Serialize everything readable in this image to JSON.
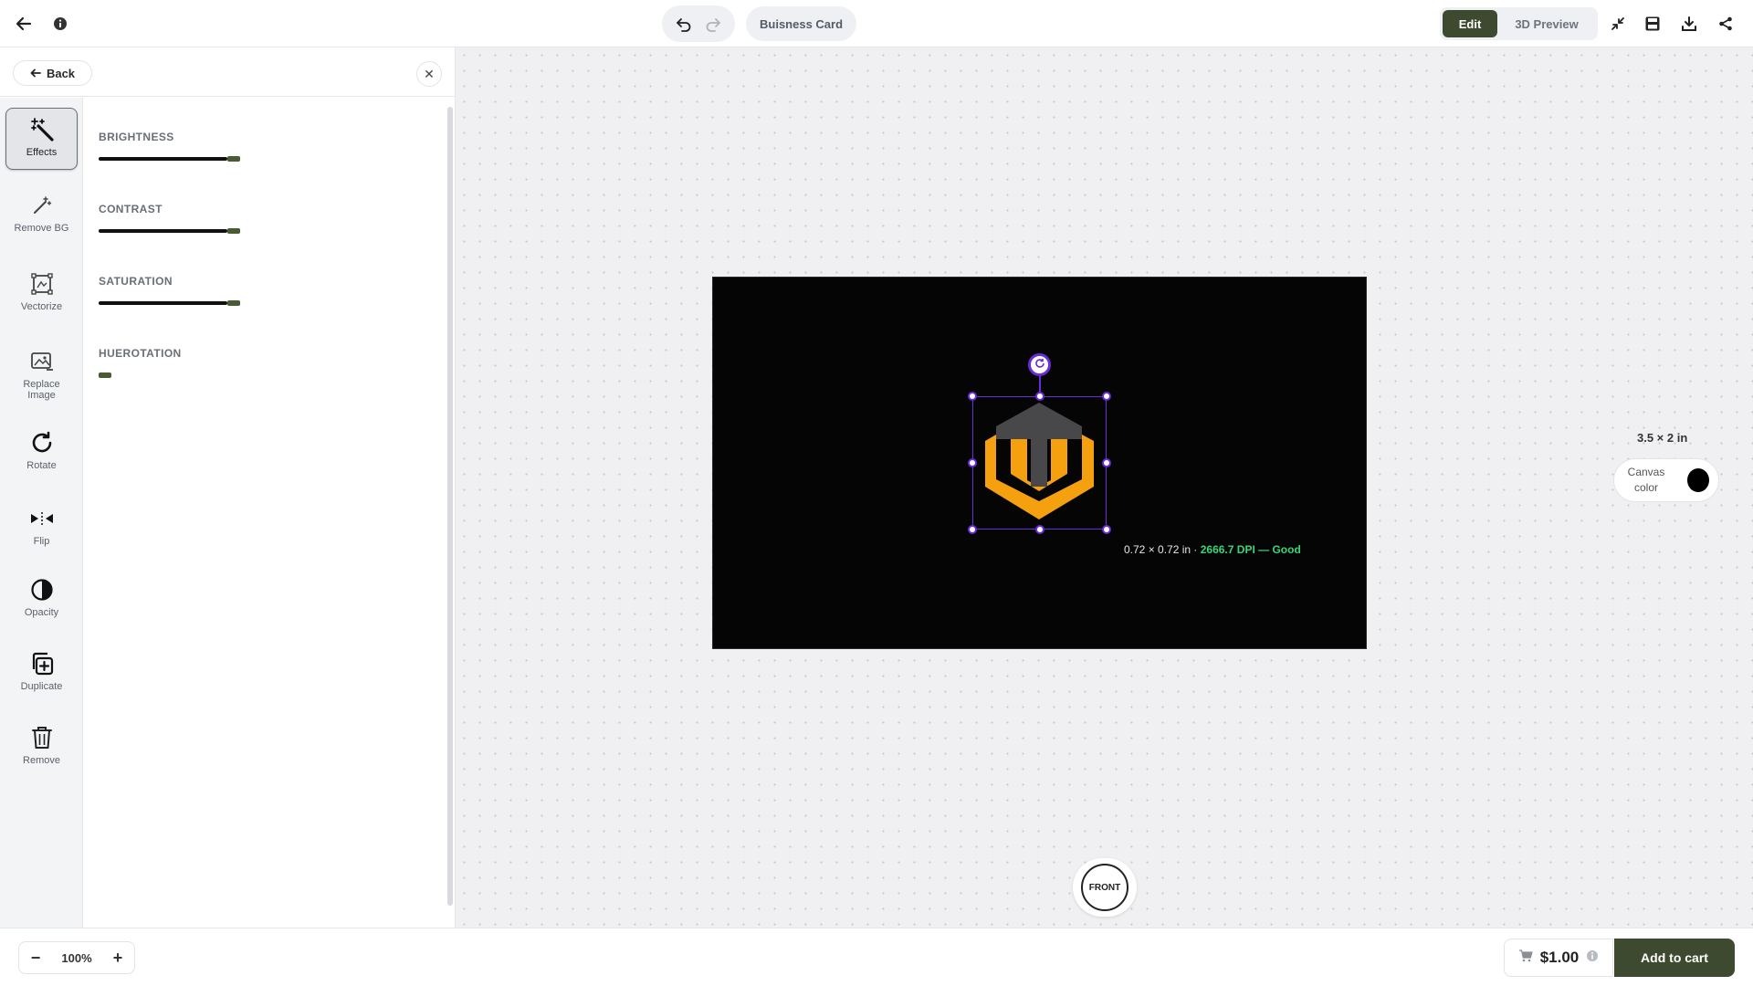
{
  "header": {
    "document_title": "Buisness Card",
    "modes": {
      "edit": "Edit",
      "preview": "3D Preview"
    },
    "active_mode": "Edit",
    "accent_color": "#3e4a2f"
  },
  "panel": {
    "back_label": "Back",
    "close_label": "✕",
    "tools": [
      {
        "label": "Effects",
        "icon": "magic-wand-icon",
        "active": true
      },
      {
        "label": "Remove BG",
        "icon": "wand-sparkle-icon"
      },
      {
        "label": "Vectorize",
        "icon": "vectorize-frame-icon"
      },
      {
        "label": "Replace Image",
        "icon": "image-edit-icon"
      },
      {
        "label": "Rotate",
        "icon": "rotate-icon"
      },
      {
        "label": "Flip",
        "icon": "flip-icon"
      },
      {
        "label": "Opacity",
        "icon": "half-circle-icon"
      },
      {
        "label": "Duplicate",
        "icon": "duplicate-icon"
      },
      {
        "label": "Remove",
        "icon": "trash-icon"
      }
    ],
    "adjustments": [
      {
        "label": "BRIGHTNESS",
        "value": 0.74
      },
      {
        "label": "CONTRAST",
        "value": 0.74
      },
      {
        "label": "SATURATION",
        "value": 0.74
      },
      {
        "label": "HUEROTATION",
        "value": 0.0
      }
    ]
  },
  "canvas": {
    "card_color": "#000000",
    "selection_color": "#6a2bd9",
    "image_size": "0.72 × 0.72 in · ",
    "dpi_status": "2666.7 DPI — Good",
    "dpi_status_color": "#37d67a",
    "card_size": "3.5 × 2 in",
    "canvas_color_label": "Canvas color",
    "canvas_color_value": "#000000",
    "side_label": "FRONT",
    "logo_colors": {
      "top": "#48474a",
      "bottom": "#f5a00f"
    }
  },
  "footer": {
    "zoom_minus": "−",
    "zoom_level": "100%",
    "zoom_plus": "+",
    "price": "$1.00",
    "add_to_cart": "Add to cart"
  }
}
